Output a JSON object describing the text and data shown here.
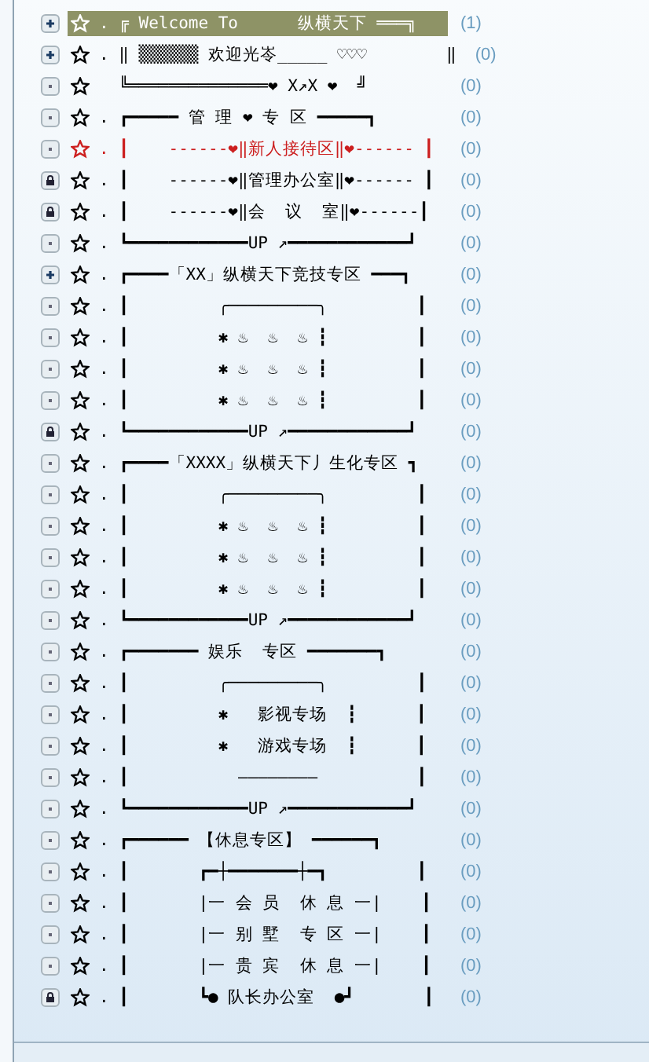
{
  "forums": [
    {
      "kind": "plus",
      "selected": true,
      "color": "#ffffff",
      "label": ". ╔ Welcome To      纵横天下 ═══╗",
      "count": "(1)"
    },
    {
      "kind": "plus",
      "selected": false,
      "color": "#000000",
      "label": ". ‖ ▒▒▒▒▒▒ 欢迎光岺_____ ♡♡♡        ‖",
      "count": "(0)"
    },
    {
      "kind": "dot",
      "selected": false,
      "color": "#000000",
      "label": "  ╚══════════════❤ X↗X ❤  ╝",
      "count": "(0)"
    },
    {
      "kind": "dot",
      "selected": false,
      "color": "#000000",
      "label": ". ┏━━━━━ 管 理 ❤ 专 区 ━━━━━┓",
      "count": "(0)"
    },
    {
      "kind": "dot",
      "selected": false,
      "color": "#cc1f1f",
      "label": ". ┃    ------❤‖新人接待区‖❤------ ┃",
      "count": "(0)"
    },
    {
      "kind": "lock",
      "selected": false,
      "color": "#000000",
      "label": ". ┃    ------❤‖管理办公室‖❤------ ┃",
      "count": "(0)"
    },
    {
      "kind": "lock",
      "selected": false,
      "color": "#000000",
      "label": ". ┃    ------❤‖会  议  室‖❤------┃",
      "count": "(0)"
    },
    {
      "kind": "dot",
      "selected": false,
      "color": "#000000",
      "label": ". ┗━━━━━━━━━━━━UP ↗━━━━━━━━━━━━┛",
      "count": "(0)"
    },
    {
      "kind": "plus",
      "selected": false,
      "color": "#000000",
      "label": ". ┏━━━━「XX」纵横天下竞技专区 ━━━┓",
      "count": "(0)"
    },
    {
      "kind": "dot",
      "selected": false,
      "color": "#000000",
      "label": ". ┃         ╭─────────╮         ┃",
      "count": "(0)"
    },
    {
      "kind": "dot",
      "selected": false,
      "color": "#000000",
      "label": ". ┃         ✱ ♨  ♨  ♨ ┇         ┃",
      "count": "(0)"
    },
    {
      "kind": "dot",
      "selected": false,
      "color": "#000000",
      "label": ". ┃         ✱ ♨  ♨  ♨ ┇         ┃",
      "count": "(0)"
    },
    {
      "kind": "dot",
      "selected": false,
      "color": "#000000",
      "label": ". ┃         ✱ ♨  ♨  ♨ ┇         ┃",
      "count": "(0)"
    },
    {
      "kind": "lock",
      "selected": false,
      "color": "#000000",
      "label": ". ┗━━━━━━━━━━━━UP ↗━━━━━━━━━━━━┛",
      "count": "(0)"
    },
    {
      "kind": "dot",
      "selected": false,
      "color": "#000000",
      "label": ". ┏━━━━「XXXX」纵横天下丿生化专区 ┓",
      "count": "(0)"
    },
    {
      "kind": "dot",
      "selected": false,
      "color": "#000000",
      "label": ". ┃         ╭─────────╮         ┃",
      "count": "(0)"
    },
    {
      "kind": "dot",
      "selected": false,
      "color": "#000000",
      "label": ". ┃         ✱ ♨  ♨  ♨ ┇         ┃",
      "count": "(0)"
    },
    {
      "kind": "dot",
      "selected": false,
      "color": "#000000",
      "label": ". ┃         ✱ ♨  ♨  ♨ ┇         ┃",
      "count": "(0)"
    },
    {
      "kind": "dot",
      "selected": false,
      "color": "#000000",
      "label": ". ┃         ✱ ♨  ♨  ♨ ┇         ┃",
      "count": "(0)"
    },
    {
      "kind": "dot",
      "selected": false,
      "color": "#000000",
      "label": ". ┗━━━━━━━━━━━━UP ↗━━━━━━━━━━━━┛",
      "count": "(0)"
    },
    {
      "kind": "dot",
      "selected": false,
      "color": "#000000",
      "label": ". ┏━━━━━━━ 娱乐  专区 ━━━━━━━┓",
      "count": "(0)"
    },
    {
      "kind": "dot",
      "selected": false,
      "color": "#000000",
      "label": ". ┃         ╭─────────╮         ┃",
      "count": "(0)"
    },
    {
      "kind": "dot",
      "selected": false,
      "color": "#000000",
      "label": ". ┃         ✱   影视专场  ┇      ┃",
      "count": "(0)"
    },
    {
      "kind": "dot",
      "selected": false,
      "color": "#000000",
      "label": ". ┃         ✱   游戏专场  ┇      ┃",
      "count": "(0)"
    },
    {
      "kind": "dot",
      "selected": false,
      "color": "#000000",
      "label": ". ┃           ————————          ┃",
      "count": "(0)"
    },
    {
      "kind": "dot",
      "selected": false,
      "color": "#000000",
      "label": ". ┗━━━━━━━━━━━━UP ↗━━━━━━━━━━━━┛",
      "count": "(0)"
    },
    {
      "kind": "dot",
      "selected": false,
      "color": "#000000",
      "label": ". ┏━━━━━━ 【休息专区】 ━━━━━━┓",
      "count": "(0)"
    },
    {
      "kind": "dot",
      "selected": false,
      "color": "#000000",
      "label": ". ┃       ┏━┼━━━━━━━┼━┓         ┃",
      "count": "(0)"
    },
    {
      "kind": "dot",
      "selected": false,
      "color": "#000000",
      "label": ". ┃       |一 会 员  休 息 一|    ┃",
      "count": "(0)"
    },
    {
      "kind": "dot",
      "selected": false,
      "color": "#000000",
      "label": ". ┃       |一 别 墅  专 区 一|    ┃",
      "count": "(0)"
    },
    {
      "kind": "dot",
      "selected": false,
      "color": "#000000",
      "label": ". ┃       |一 贵 宾  休 息 一|    ┃",
      "count": "(0)"
    },
    {
      "kind": "lock",
      "selected": false,
      "color": "#000000",
      "label": ". ┃       ┗● 队长办公室  ●┛       ┃",
      "count": "(0)"
    }
  ]
}
